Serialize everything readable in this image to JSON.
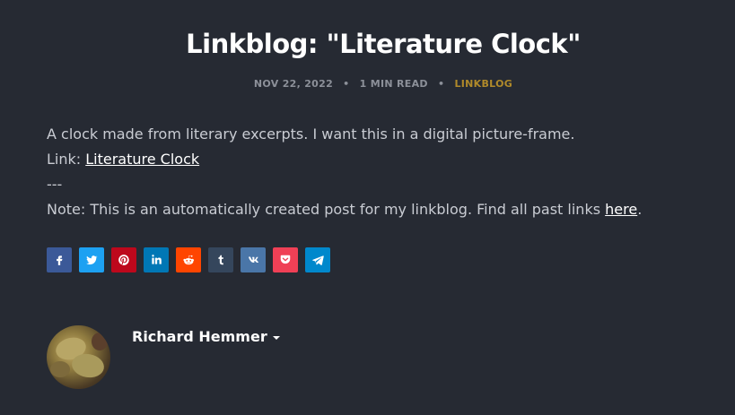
{
  "post": {
    "title": "Linkblog: \"Literature Clock\"",
    "date": "NOV 22, 2022",
    "read_time": "1 MIN READ",
    "tag": "LINKBLOG"
  },
  "content": {
    "line1": "A clock made from literary excerpts. I want this in a digital picture-frame.",
    "link_prefix": "Link: ",
    "link_text": "Literature Clock",
    "separator": "---",
    "note_prefix": "Note: This is an automatically created post for my linkblog. Find all past links ",
    "note_link": "here",
    "note_suffix": "."
  },
  "share": [
    {
      "name": "facebook",
      "color": "#3b5998"
    },
    {
      "name": "twitter",
      "color": "#1da1f2"
    },
    {
      "name": "pinterest",
      "color": "#bd081c"
    },
    {
      "name": "linkedin",
      "color": "#0077b5"
    },
    {
      "name": "reddit",
      "color": "#ff4500"
    },
    {
      "name": "tumblr",
      "color": "#35465c"
    },
    {
      "name": "vk",
      "color": "#4a76a8"
    },
    {
      "name": "pocket",
      "color": "#ef4056"
    },
    {
      "name": "telegram",
      "color": "#0088cc"
    }
  ],
  "author": {
    "name": "Richard Hemmer"
  }
}
